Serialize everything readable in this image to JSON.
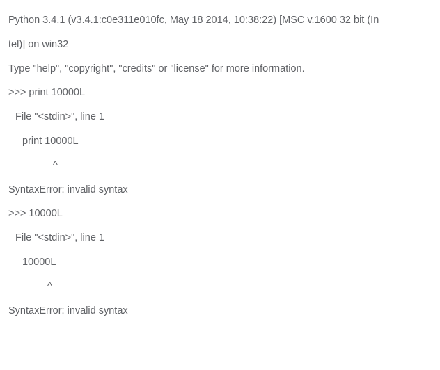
{
  "banner_line1": "Python 3.4.1 (v3.4.1:c0e311e010fc, May 18 2014, 10:38:22) [MSC v.1600 32 bit (In",
  "banner_line2": "tel)] on win32",
  "help_line": "Type \"help\", \"copyright\", \"credits\" or \"license\" for more information.",
  "prompt_1": ">>> print 10000L",
  "trace_1_file": "File \"<stdin>\", line 1",
  "trace_1_code": "print 10000L",
  "trace_1_caret": "^",
  "error_1": "SyntaxError: invalid syntax",
  "prompt_2": ">>> 10000L",
  "trace_2_file": "File \"<stdin>\", line 1",
  "trace_2_code": "10000L",
  "trace_2_caret": "^",
  "error_2": "SyntaxError: invalid syntax"
}
